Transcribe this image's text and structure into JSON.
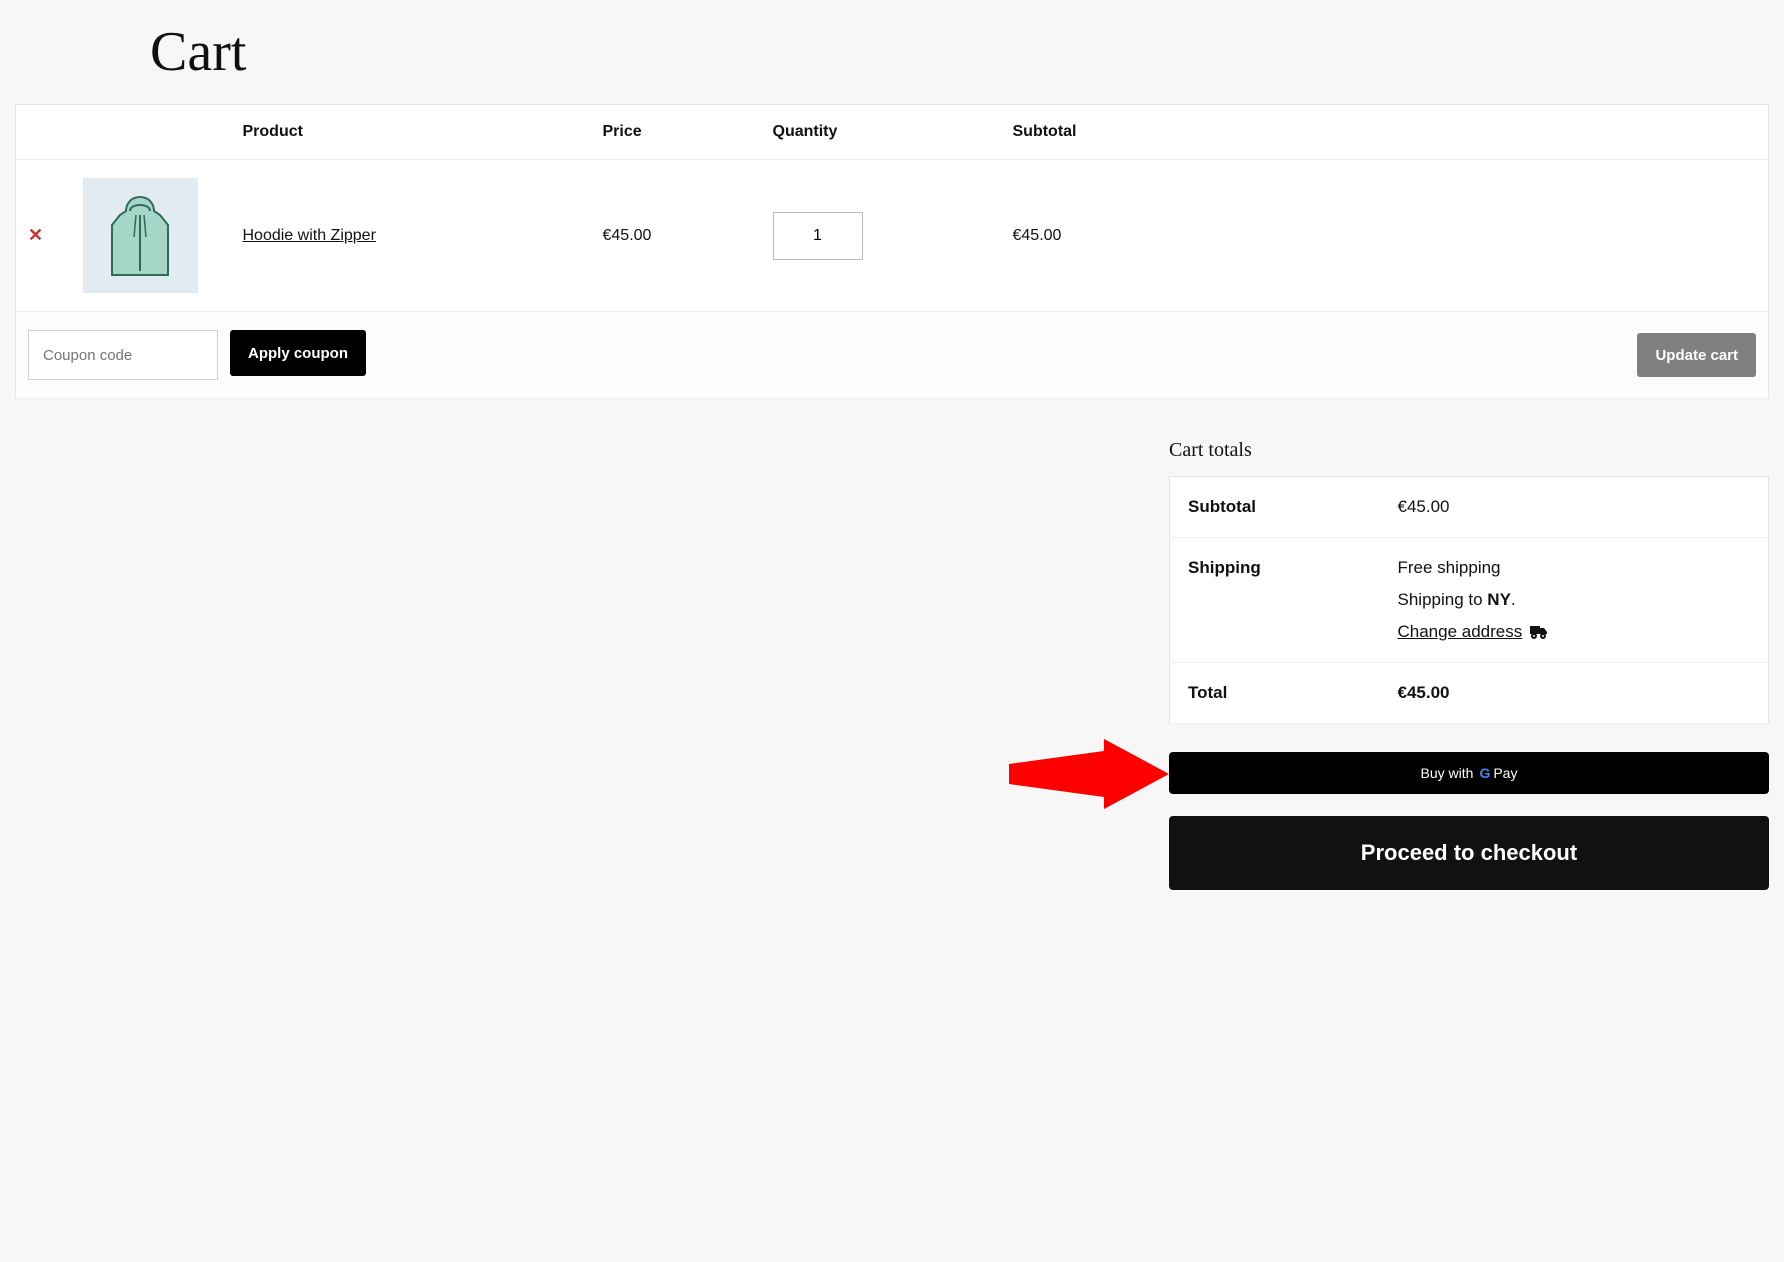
{
  "page": {
    "title": "Cart"
  },
  "table": {
    "headers": {
      "product": "Product",
      "price": "Price",
      "quantity": "Quantity",
      "subtotal": "Subtotal"
    },
    "items": [
      {
        "name": "Hoodie with Zipper",
        "price": "€45.00",
        "quantity": "1",
        "subtotal": "€45.00"
      }
    ],
    "coupon_placeholder": "Coupon code",
    "apply_coupon_label": "Apply coupon",
    "update_cart_label": "Update cart"
  },
  "totals": {
    "title": "Cart totals",
    "subtotal_label": "Subtotal",
    "subtotal_value": "€45.00",
    "shipping_label": "Shipping",
    "shipping_method": "Free shipping",
    "shipping_to_prefix": "Shipping to ",
    "shipping_to_region": "NY",
    "shipping_to_suffix": ".",
    "change_address_label": "Change address",
    "total_label": "Total",
    "total_value": "€45.00"
  },
  "buttons": {
    "gpay_prefix": "Buy with",
    "gpay_brand_pay": "Pay",
    "checkout_label": "Proceed to checkout"
  },
  "colors": {
    "remove_red": "#c9302c",
    "annotation_red": "#ff0000"
  }
}
